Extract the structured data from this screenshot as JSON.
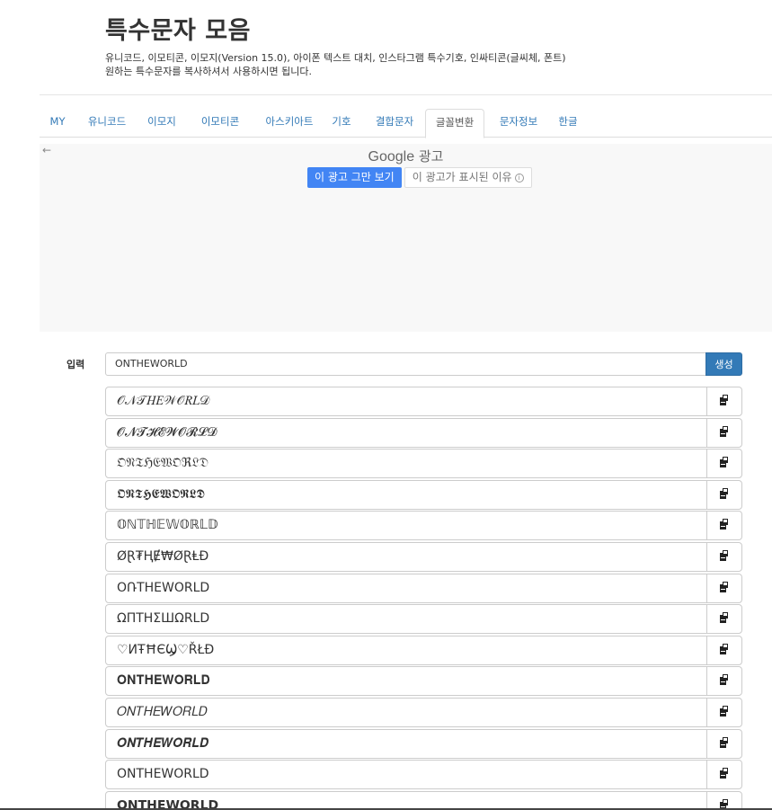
{
  "header": {
    "title": "특수문자 모음",
    "desc1": "유니코드, 이모티콘, 이모지(Version 15.0), 아이폰 텍스트 대치, 인스타그램 특수기호, 인싸티콘(글씨체, 폰트)",
    "desc2": "원하는 특수문자를 복사하셔서 사용하시면 됩니다."
  },
  "tabs": [
    "MY",
    "유니코드",
    "이모지",
    "이모티콘",
    "아스키아트",
    "기호",
    "결합문자",
    "글꼴변환",
    "문자정보",
    "한글"
  ],
  "active_tab": "글꼴변환",
  "ad": {
    "back": "←",
    "google": "Google",
    "label": "광고",
    "stop": "이 광고 그만 보기",
    "why": "이 광고가 표시된 이유",
    "info": "i"
  },
  "input": {
    "label": "입력",
    "value": "ONTHEWORLD",
    "button": "생성"
  },
  "results": [
    "𝒪𝒩𝒯𝐻𝐸𝒲𝒪𝑅𝐿𝒟",
    "𝓞𝓝𝓣𝓗𝓔𝓦𝓞𝓡𝓛𝓓",
    "𝔒𝔑𝔗ℌ𝔈𝔚𝔒ℜ𝔏𝔇",
    "𝕺𝕹𝕿𝕳𝕰𝖂𝕺𝕽𝕷𝕯",
    "𝕆ℕ𝕋ℍ𝔼𝕎𝕆ℝ𝕃𝔻",
    "ØⱤ₮ⱧɆ₩ØⱤⱠĐ",
    "OՌTHEWORLD",
    "ΩΠTHΣШΩRLD",
    "♡ИŦĦЄϢ♡ŘŁÐ",
    "𝐎𝐍𝐓𝐇𝐄𝐖𝐎𝐑𝐋𝐃",
    "𝑂𝑁𝑇𝐻𝐸𝑊𝑂𝑅𝐿𝐷",
    "𝑶𝑵𝑻𝑯𝑬𝑾𝑶𝑹𝑳𝑫",
    "𝖮𝖭𝖳𝖧𝖤𝖶𝖮𝖱𝖫𝖣",
    "𝗢𝗡𝗧𝗛𝗘𝗪𝗢𝗥𝗟𝗗"
  ],
  "icons": {
    "copy": "clipboard-icon"
  }
}
